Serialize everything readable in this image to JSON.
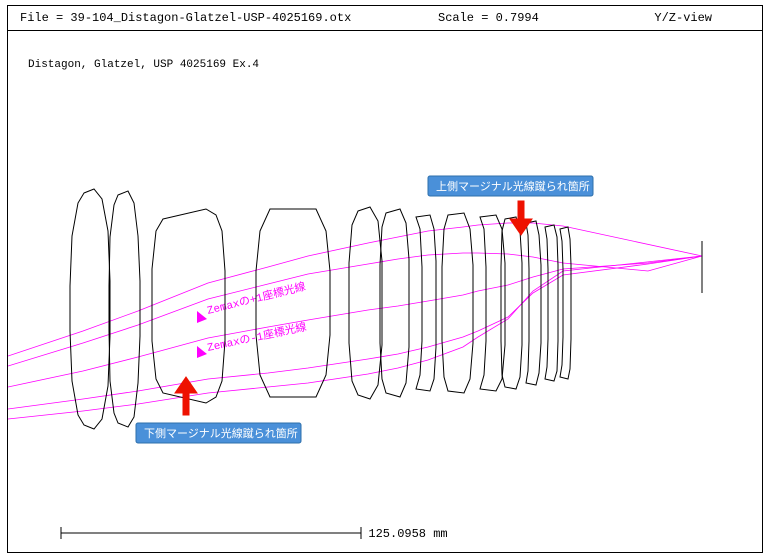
{
  "header": {
    "file_label": "File = ",
    "file_value": "39-104_Distagon-Glatzel-USP-4025169.otx",
    "scale_label": "Scale = ",
    "scale_value": "0.7994",
    "view": "Y/Z-view"
  },
  "caption": "Distagon, Glatzel, USP 4025169 Ex.4",
  "ray_labels": {
    "plus1": "Zemaxの+1座標光線",
    "minus1": "Zemaxの-1座標光線"
  },
  "callouts": {
    "top": "上側マージナル光線蹴られ箇所",
    "bottom": "下側マージナル光線蹴られ箇所"
  },
  "scale_bar": "125.0958 mm"
}
